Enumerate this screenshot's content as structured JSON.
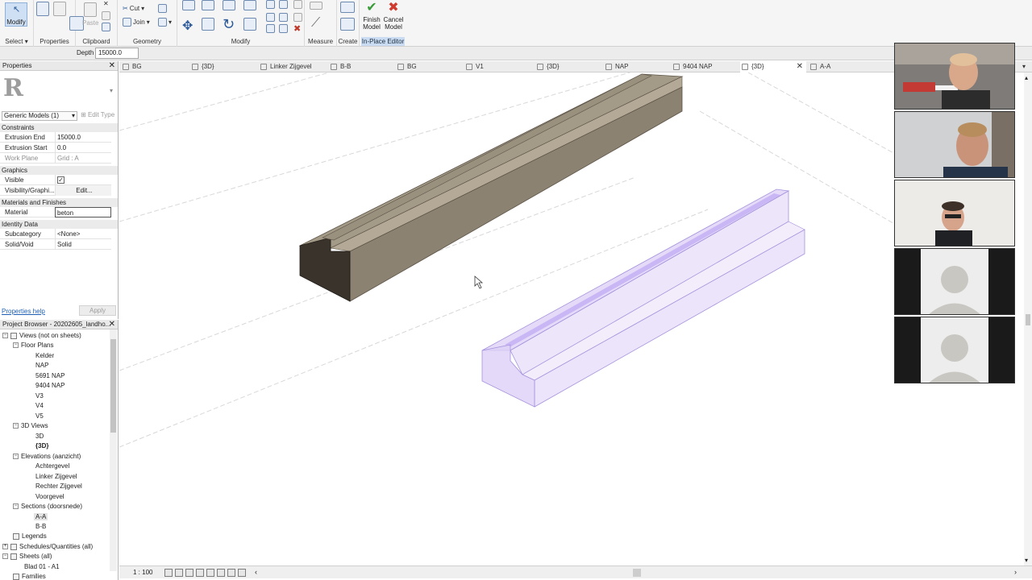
{
  "ribbon": {
    "select_label": "Select ▾",
    "modify_label": "Modify",
    "clipboard": {
      "cut": "Cut",
      "join": "Join",
      "paste": "Paste",
      "panel": "Clipboard"
    },
    "panels": {
      "select": "Select",
      "properties": "Properties",
      "clipboard": "Clipboard",
      "geometry": "Geometry",
      "modify": "Modify",
      "measure": "Measure",
      "create": "Create",
      "inplace": "In-Place Editor"
    },
    "finish_model": [
      "Finish",
      "Model"
    ],
    "cancel_model": [
      "Cancel",
      "Model"
    ]
  },
  "options_bar": {
    "depth_label": "Depth",
    "depth_value": "15000.0"
  },
  "properties": {
    "title": "Properties",
    "type_selector": "Generic Models (1)",
    "edit_type": "Edit Type",
    "sections": {
      "constraints": "Constraints",
      "graphics": "Graphics",
      "materials": "Materials and Finishes",
      "identity": "Identity Data"
    },
    "rows": {
      "extrusion_end": {
        "key": "Extrusion End",
        "value": "15000.0"
      },
      "extrusion_start": {
        "key": "Extrusion Start",
        "value": "0.0"
      },
      "work_plane": {
        "key": "Work Plane",
        "value": "Grid : A"
      },
      "visible": {
        "key": "Visible",
        "value": "✓"
      },
      "visibility": {
        "key": "Visibility/Graphi...",
        "value": "Edit..."
      },
      "material": {
        "key": "Material",
        "value": "beton"
      },
      "subcategory": {
        "key": "Subcategory",
        "value": "<None>"
      },
      "solid_void": {
        "key": "Solid/Void",
        "value": "Solid"
      }
    },
    "help": "Properties help",
    "apply": "Apply"
  },
  "browser": {
    "title": "Project Browser - 20202605_landho...",
    "nodes": {
      "views": "Views (not on sheets)",
      "floor_plans": "Floor Plans",
      "kelder": "Kelder",
      "nap": "NAP",
      "nap5691": "5691 NAP",
      "nap9404": "9404 NAP",
      "v3": "V3",
      "v4": "V4",
      "v5": "V5",
      "views3d": "3D Views",
      "v3d": "3D",
      "v3d_b": "{3D}",
      "elevations": "Elevations (aanzicht)",
      "achtergevel": "Achtergevel",
      "linker": "Linker Zijgevel",
      "rechter": "Rechter Zijgevel",
      "voorgevel": "Voorgevel",
      "sections": "Sections (doorsnede)",
      "aa": "A-A",
      "bb": "B-B",
      "legends": "Legends",
      "schedules": "Schedules/Quantities (all)",
      "sheets": "Sheets (all)",
      "blad": "Blad 01 - A1",
      "families": "Families"
    }
  },
  "tabs": [
    "BG",
    "{3D}",
    "Linker Zijgevel",
    "B-B",
    "BG",
    "V1",
    "{3D}",
    "NAP",
    "9404 NAP",
    "{3D}",
    "A-A"
  ],
  "active_tab_index": 9,
  "status": {
    "scale": "1 : 100"
  },
  "colors": {
    "concrete": "#8c8272",
    "concrete_top": "#a49a88",
    "concrete_end": "#3a332b",
    "ghost": "#cdbcf0",
    "ghost_edge": "#a592dc"
  }
}
